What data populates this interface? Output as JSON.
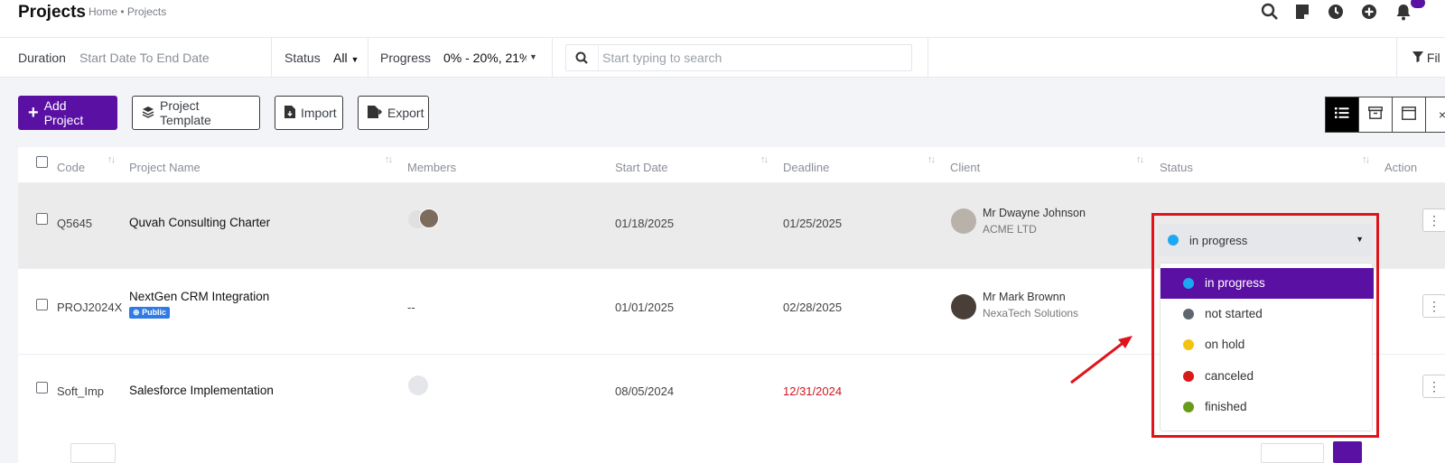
{
  "header": {
    "title": "Projects",
    "breadcrumb": "Home • Projects",
    "icons": [
      "search-icon",
      "sticky-note-icon",
      "clock-icon",
      "plus-circle-icon",
      "bell-icon"
    ]
  },
  "filters": {
    "duration_label": "Duration",
    "duration_value": "Start Date To End Date",
    "status_label": "Status",
    "status_value": "All",
    "progress_label": "Progress",
    "progress_value": "0% - 20%, 21%",
    "search_placeholder": "Start typing to search",
    "filter_label": "Fil"
  },
  "toolbar": {
    "add_project": "Add Project",
    "project_template": "Project Template",
    "import": "Import",
    "export": "Export"
  },
  "table": {
    "headers": {
      "code": "Code",
      "project_name": "Project Name",
      "members": "Members",
      "start_date": "Start Date",
      "deadline": "Deadline",
      "client": "Client",
      "status": "Status",
      "action": "Action"
    },
    "rows": [
      {
        "code": "Q5645",
        "name": "Quvah Consulting Charter",
        "members": "",
        "start_date": "01/18/2025",
        "deadline": "01/25/2025",
        "client_name": "Mr Dwayne Johnson",
        "client_company": "ACME LTD"
      },
      {
        "code": "PROJ2024X",
        "name": "NextGen CRM Integration",
        "badge": "Public",
        "members": "--",
        "start_date": "01/01/2025",
        "deadline": "02/28/2025",
        "client_name": "Mr Mark Brownn",
        "client_company": "NexaTech Solutions"
      },
      {
        "code": "Soft_Imp",
        "name": "Salesforce Implementation",
        "members": "",
        "start_date": "08/05/2024",
        "deadline": "12/31/2024",
        "client_name": "",
        "client_company": ""
      }
    ]
  },
  "status_select": {
    "current": "in progress",
    "options": [
      {
        "label": "in progress",
        "color": "#1ea7f2"
      },
      {
        "label": "not started",
        "color": "#5f6670"
      },
      {
        "label": "on hold",
        "color": "#f4c211"
      },
      {
        "label": "canceled",
        "color": "#d91a1a"
      },
      {
        "label": "finished",
        "color": "#689b1a"
      }
    ]
  },
  "colors": {
    "brand": "#5b10a4",
    "annotation": "#e0141c",
    "overdue": "#d0161c"
  }
}
